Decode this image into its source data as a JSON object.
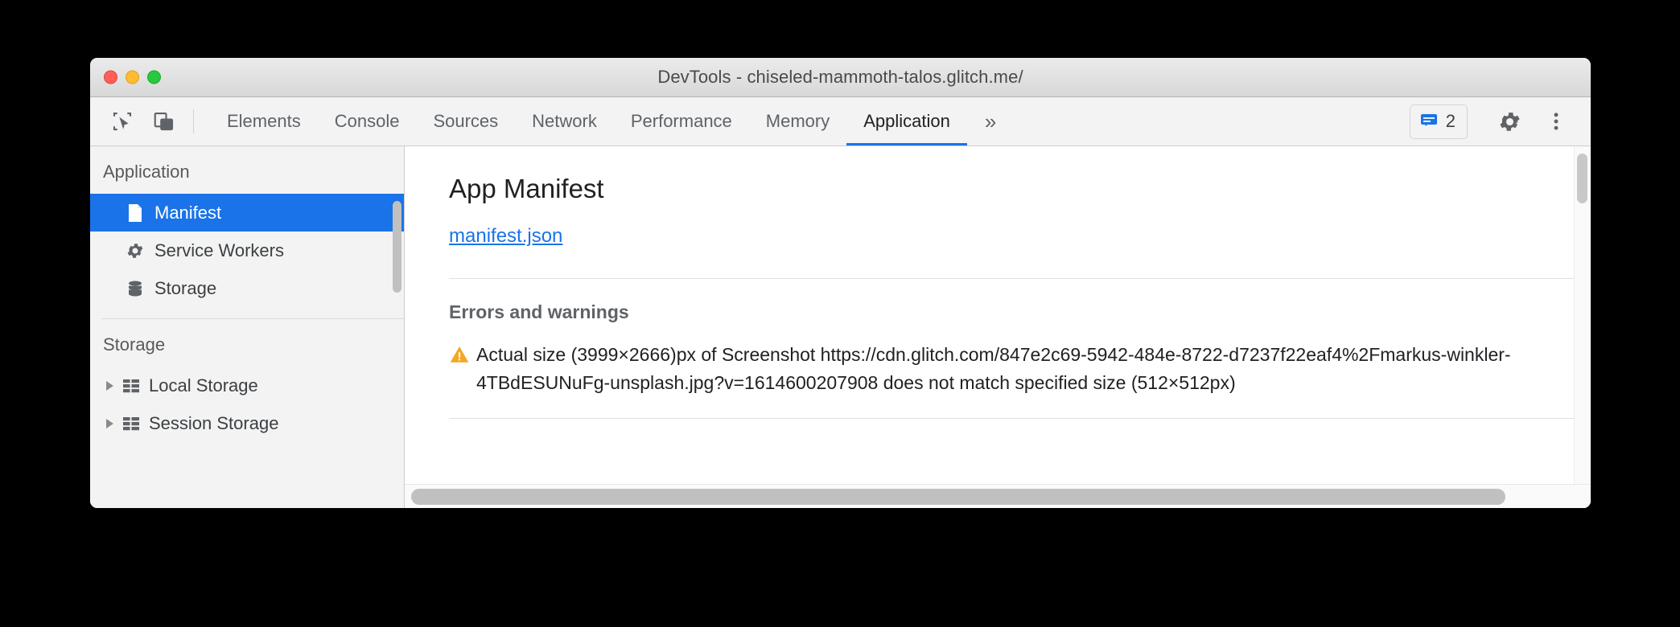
{
  "window": {
    "title": "DevTools - chiseled-mammoth-talos.glitch.me/",
    "traffic_lights": [
      "close",
      "minimize",
      "zoom"
    ]
  },
  "toolbar": {
    "inspect_icon": "inspect-element-icon",
    "device_icon": "device-toolbar-icon",
    "tabs": [
      {
        "label": "Elements",
        "active": false
      },
      {
        "label": "Console",
        "active": false
      },
      {
        "label": "Sources",
        "active": false
      },
      {
        "label": "Network",
        "active": false
      },
      {
        "label": "Performance",
        "active": false
      },
      {
        "label": "Memory",
        "active": false
      },
      {
        "label": "Application",
        "active": true
      }
    ],
    "more_tabs_label": "»",
    "message_badge": {
      "icon": "message-icon",
      "count": "2",
      "color": "#1a73e8"
    },
    "settings_icon": "gear-icon",
    "menu_icon": "more-vertical-icon"
  },
  "sidebar": {
    "sections": [
      {
        "header": "Application",
        "items": [
          {
            "label": "Manifest",
            "icon": "document-icon",
            "selected": true
          },
          {
            "label": "Service Workers",
            "icon": "gear-icon",
            "selected": false
          },
          {
            "label": "Storage",
            "icon": "database-icon",
            "selected": false
          }
        ]
      },
      {
        "header": "Storage",
        "items": [
          {
            "label": "Local Storage",
            "icon": "table-icon",
            "expandable": true
          },
          {
            "label": "Session Storage",
            "icon": "table-icon",
            "expandable": true
          }
        ]
      }
    ]
  },
  "main": {
    "title": "App Manifest",
    "manifest_link": "manifest.json",
    "errors_section": {
      "title": "Errors and warnings",
      "items": [
        {
          "icon": "warning-triangle-icon",
          "text": "Actual size (3999×2666)px of Screenshot https://cdn.glitch.com/847e2c69-5942-484e-8722-d7237f22eaf4%2Fmarkus-winkler-4TBdESUNuFg-unsplash.jpg?v=1614600207908 does not match specified size (512×512px)"
        }
      ]
    }
  },
  "colors": {
    "accent": "#1a73e8",
    "warning": "#f5a623",
    "text": "#202124",
    "muted": "#5f6368"
  }
}
